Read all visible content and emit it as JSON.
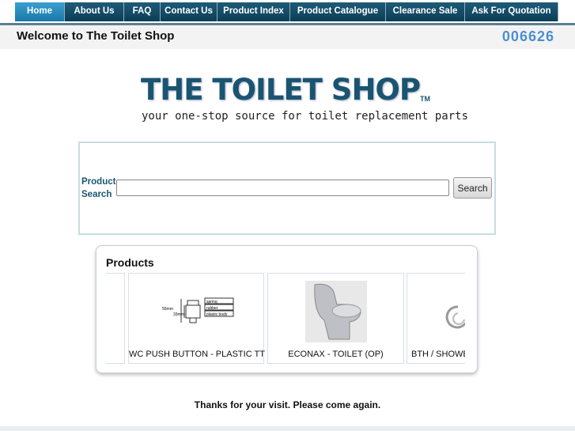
{
  "nav": [
    {
      "label": "Home",
      "active": true
    },
    {
      "label": "About Us"
    },
    {
      "label": "FAQ"
    },
    {
      "label": "Contact Us"
    },
    {
      "label": "Product Index"
    },
    {
      "label": "Product Catalogue"
    },
    {
      "label": "Clearance Sale"
    },
    {
      "label": "Ask For Quotation"
    }
  ],
  "header": {
    "welcome": "Welcome to The Toilet Shop",
    "counter": "006626"
  },
  "logo": {
    "title": "THE TOILET SHOP",
    "tm": "TM",
    "tagline": "your one-stop source for toilet replacement parts"
  },
  "search": {
    "label": "Product Search",
    "value": "",
    "button": "Search"
  },
  "products": {
    "title": "Products",
    "items": [
      {
        "caption": "WC PUSH BUTTON - PLASTIC TT",
        "diagram_labels": [
          "spring",
          "rubber",
          "plastic body",
          "55mm",
          "33mm"
        ]
      },
      {
        "caption": "ECONAX - TOILET (OP)"
      },
      {
        "caption": "BTH / SHOWER"
      }
    ]
  },
  "footer": {
    "thanks": "Thanks for your visit. Please come again."
  }
}
